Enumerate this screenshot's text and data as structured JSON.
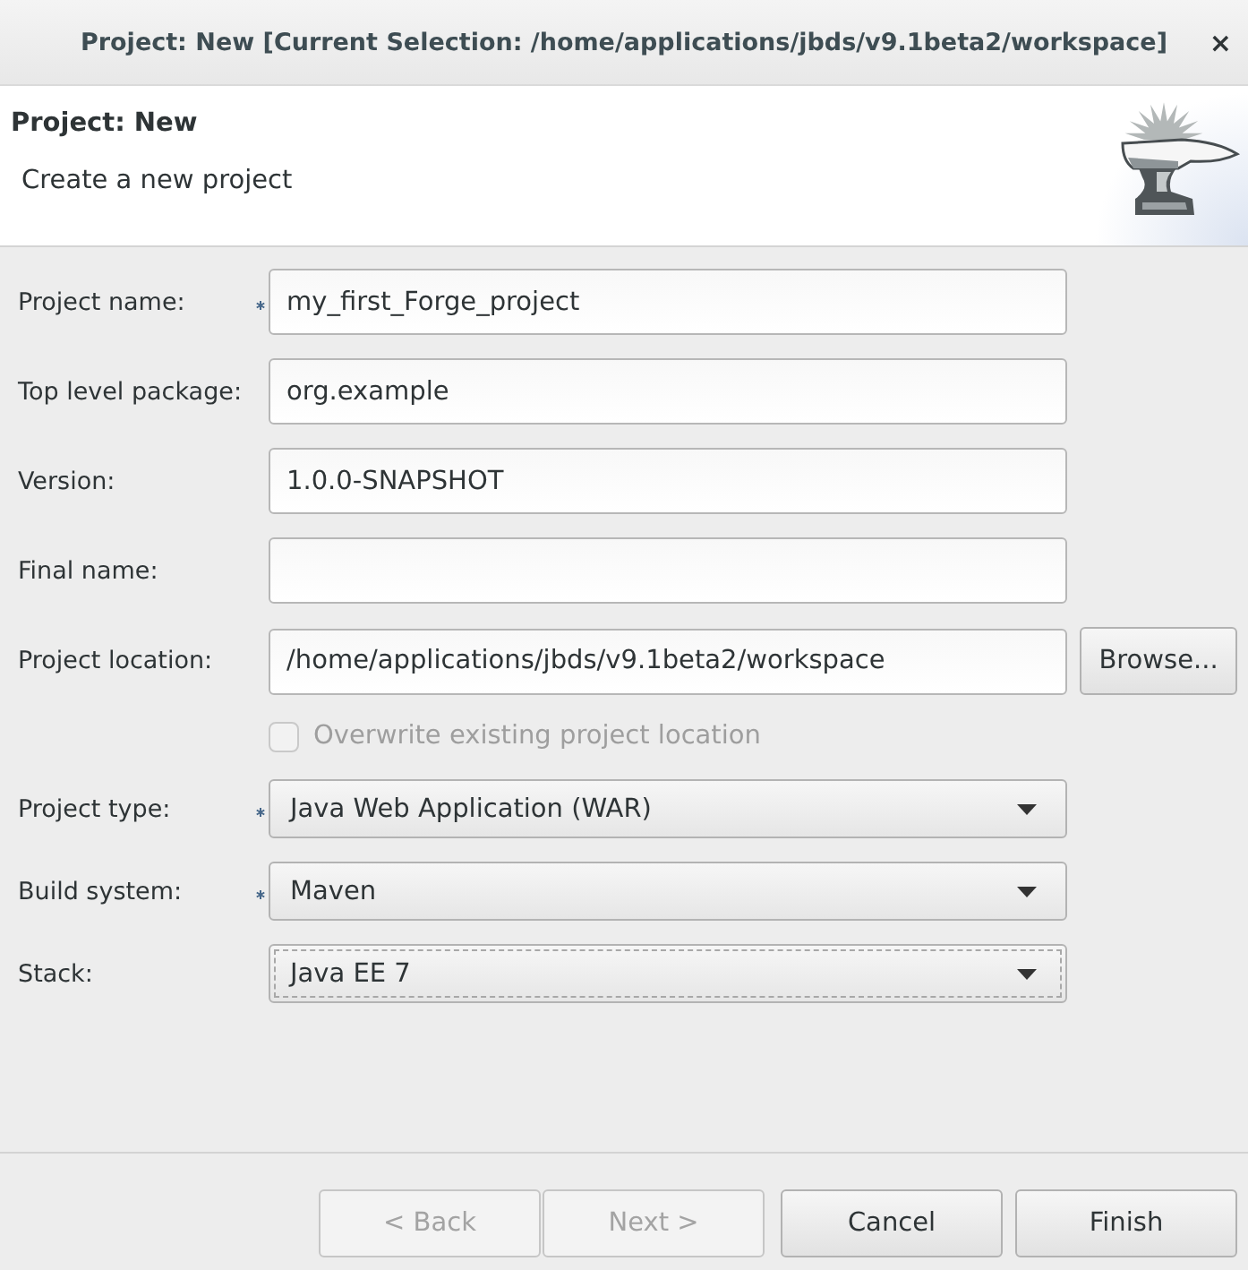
{
  "window": {
    "title": "Project: New [Current Selection: /home/applications/jbds/v9.1beta2/workspace]",
    "close": "×"
  },
  "header": {
    "title": "Project: New",
    "description": "Create a new project"
  },
  "form": {
    "fields": [
      {
        "kind": "text",
        "label": "Project name:",
        "required": true,
        "value": "my_first_Forge_project",
        "focused": false,
        "disabled": false
      },
      {
        "kind": "text",
        "label": "Top level package:",
        "required": false,
        "value": "org.example",
        "focused": false,
        "disabled": false
      },
      {
        "kind": "text",
        "label": "Version:",
        "required": false,
        "value": "1.0.0-SNAPSHOT",
        "focused": false,
        "disabled": false
      },
      {
        "kind": "text",
        "label": "Final name:",
        "required": false,
        "focused": false,
        "disabled": false
      },
      {
        "kind": "text_browse",
        "label": "Project location:",
        "required": false,
        "value": "/home/applications/jbds/v9.1beta2/workspace",
        "button": "Browse...",
        "focused": false,
        "disabled": false
      },
      {
        "kind": "checkbox",
        "label": "Overwrite existing project location",
        "required": false,
        "checked": false,
        "focused": false,
        "disabled": true
      },
      {
        "kind": "dropdown",
        "label": "Project type:",
        "required": true,
        "value": "Java Web Application (WAR)",
        "focused": false,
        "disabled": false
      },
      {
        "kind": "dropdown",
        "label": "Build system:",
        "required": true,
        "value": "Maven",
        "focused": false,
        "disabled": false
      },
      {
        "kind": "dropdown",
        "label": "Stack:",
        "required": false,
        "value": "Java EE 7",
        "focused": true,
        "disabled": false
      }
    ]
  },
  "buttons": [
    {
      "label": "< Back",
      "disabled": true
    },
    {
      "label": "Next >",
      "disabled": true
    },
    {
      "label": "Cancel",
      "disabled": false
    },
    {
      "label": "Finish",
      "disabled": false
    }
  ]
}
